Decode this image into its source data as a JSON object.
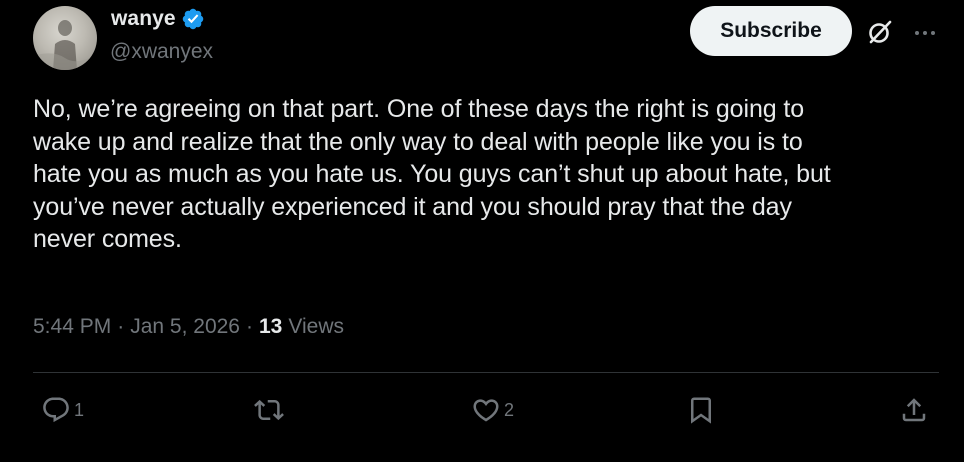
{
  "author": {
    "display_name": "wanye",
    "handle": "@xwanyex",
    "verified_color": "#1d9bf0"
  },
  "header": {
    "subscribe_label": "Subscribe",
    "grok_icon": "grok-icon",
    "more_icon": "more-icon"
  },
  "tweet": {
    "text": "No, we’re agreeing on that part. One of these days the right is going to\nwake up and realize that the only way to deal with people like you is to\nhate you as much as you hate us. You guys can’t shut up about hate, but\nyou’ve never actually experienced it and you should pray that the day\nnever comes."
  },
  "meta": {
    "time": "5:44 PM",
    "separator1": "·",
    "date": "Jan 5, 2026",
    "separator2": "·",
    "views_count": "13",
    "views_label": "Views"
  },
  "actions": {
    "reply_count": "1",
    "repost_count": "",
    "like_count": "2"
  },
  "colors": {
    "background": "#000000",
    "text": "#e7e9ea",
    "secondary": "#71767b",
    "divider": "#2f3336",
    "button_bg": "#eff3f4"
  }
}
